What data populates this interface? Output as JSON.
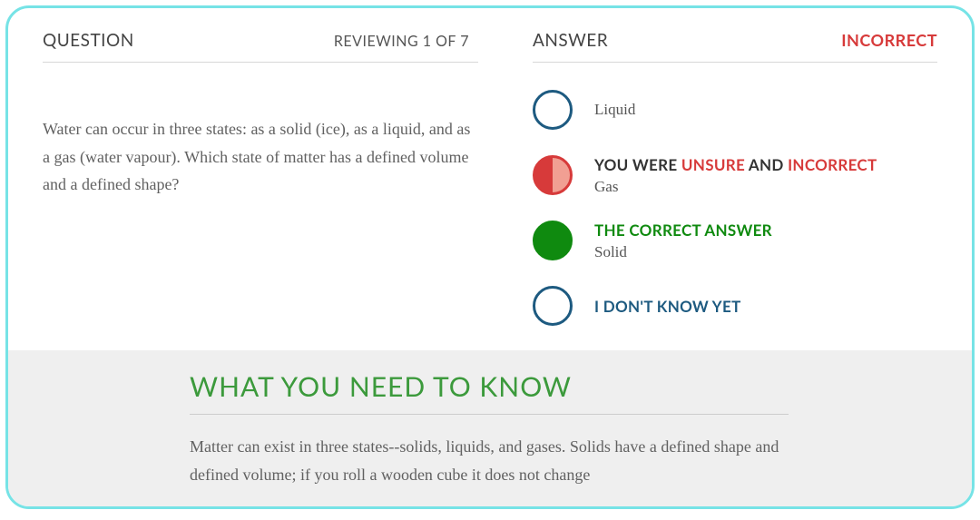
{
  "header": {
    "question_label": "QUESTION",
    "review_label": "REVIEWING 1 OF 7",
    "answer_label": "ANSWER",
    "status_label": "INCORRECT"
  },
  "question": {
    "text": "Water can occur in three states: as a solid (ice), as a liquid, and as a gas (water vapour). Which state of matter has a defined volume and a defined shape?"
  },
  "answers": [
    {
      "circle": "empty",
      "tag": null,
      "text": "Liquid"
    },
    {
      "circle": "red-half",
      "tag_parts": [
        "YOU WERE ",
        "UNSURE",
        " AND ",
        "INCORRECT"
      ],
      "text": "Gas"
    },
    {
      "circle": "green",
      "tag": "THE CORRECT ANSWER",
      "tag_class": "green",
      "text": "Solid"
    },
    {
      "circle": "empty",
      "tag": "I DON'T KNOW YET",
      "tag_class": "blue",
      "text": null
    }
  ],
  "info": {
    "title": "WHAT YOU NEED TO KNOW",
    "body": "Matter can exist in three states--solids, liquids, and gases.  Solids have a defined shape and defined volume; if you roll a wooden cube it does not change"
  }
}
